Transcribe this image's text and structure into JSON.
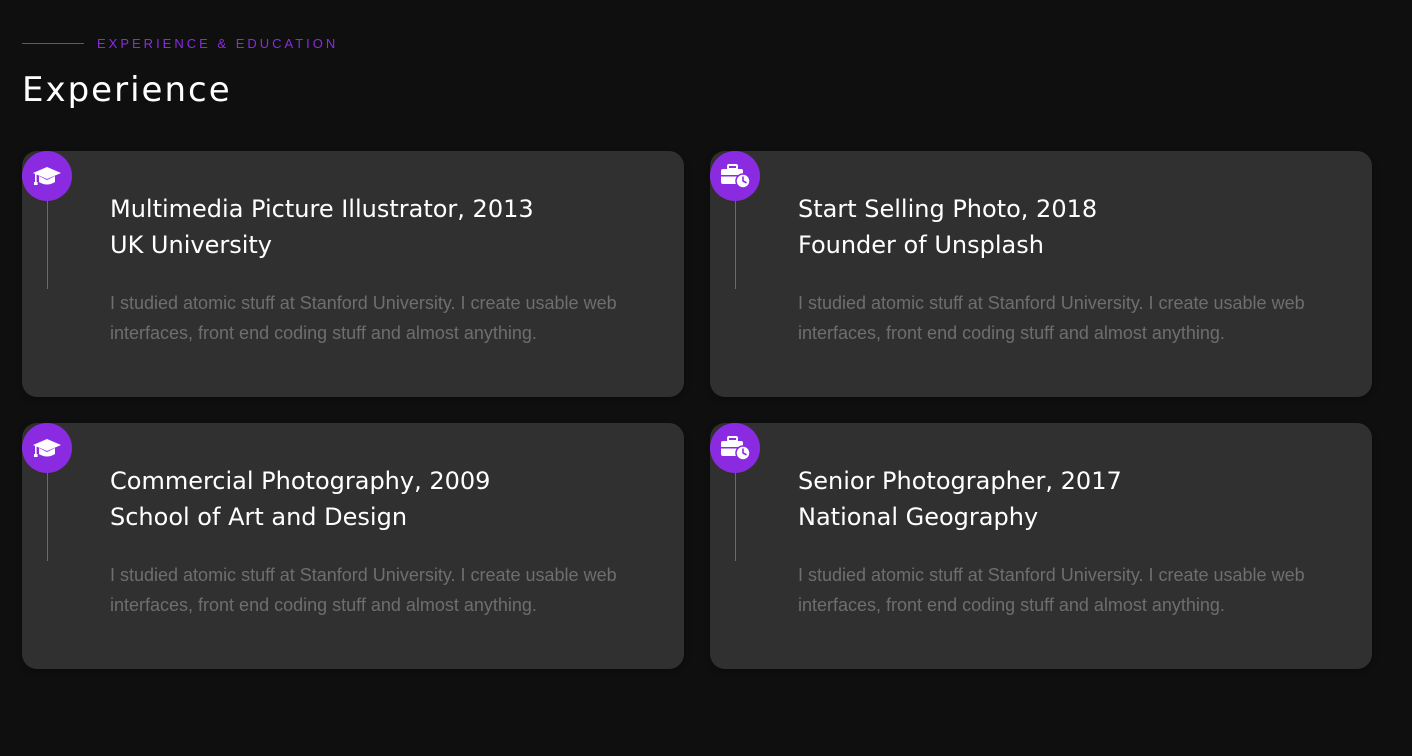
{
  "header": {
    "eyebrow": "EXPERIENCE & EDUCATION",
    "title": "Experience"
  },
  "theme": {
    "accent": "#8a2be2",
    "background": "#0f0f10",
    "card": "#303030"
  },
  "cards": [
    {
      "icon": "graduation-cap-icon",
      "line1": "Multimedia Picture Illustrator, 2013",
      "line2": "UK University",
      "description": "I studied atomic stuff at Stanford University. I create usable web interfaces, front end coding stuff and almost anything."
    },
    {
      "icon": "briefcase-clock-icon",
      "line1": "Start Selling Photo, 2018",
      "line2": "Founder of Unsplash",
      "description": "I studied atomic stuff at Stanford University. I create usable web interfaces, front end coding stuff and almost anything."
    },
    {
      "icon": "graduation-cap-icon",
      "line1": "Commercial Photography, 2009",
      "line2": "School of Art and Design",
      "description": "I studied atomic stuff at Stanford University. I create usable web interfaces, front end coding stuff and almost anything."
    },
    {
      "icon": "briefcase-clock-icon",
      "line1": "Senior Photographer, 2017",
      "line2": "National Geography",
      "description": "I studied atomic stuff at Stanford University. I create usable web interfaces, front end coding stuff and almost anything."
    }
  ]
}
